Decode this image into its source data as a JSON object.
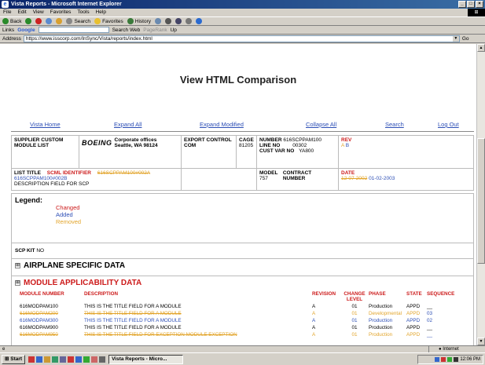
{
  "window": {
    "title": "Vista Reports - Microsoft Internet Explorer",
    "buttons": [
      "_",
      "□",
      "×"
    ]
  },
  "menu": [
    "File",
    "Edit",
    "View",
    "Favorites",
    "Tools",
    "Help"
  ],
  "toolbar": {
    "back": "Back",
    "search": "Search",
    "favorites": "Favorites",
    "history": "History"
  },
  "links_bar": {
    "links_label": "Links",
    "google": "Google",
    "search_web": "Search Web",
    "pagerank": "PageRank",
    "up": "Up"
  },
  "address": {
    "label": "Address",
    "url": "https://www.isscorp.com/InSync/Vista/reports/index.html",
    "go": "Go"
  },
  "page": {
    "title": "View HTML Comparison",
    "nav": [
      "Vista Home",
      "Expand All",
      "Expand Modified",
      "Collapse All",
      "Search",
      "Log Out"
    ]
  },
  "header": {
    "supplier_label": "SUPPLIER CUSTOM MODULE LIST",
    "boeing_logo": "BOEING",
    "corporate": "Corporate offices",
    "city": "Seattle, WA 98124",
    "export_label": "EXPORT CONTROL COM",
    "cage_label": "CAGE",
    "cage_value": "81205",
    "number_label": "NUMBER",
    "number_value": "616SCPPAM100",
    "line_label": "LINE NO",
    "line_value": "00302",
    "custvar_label": "CUST VAR NO",
    "custvar_value": "YA800",
    "rev_label": "REV",
    "rev_old": "A",
    "rev_new": "B",
    "list_title_label": "LIST TITLE",
    "list_title_value": "DESCRIPTION FIELD FOR SCP",
    "scml_label": "SCML IDENTIFIER",
    "scml_old": "616SCPPAM100#002A",
    "scml_new": "616SCPPAM100#002B",
    "model_label": "MODEL",
    "model_value": "757",
    "contract_label": "CONTRACT NUMBER",
    "date_label": "DATE",
    "date_old": "12-07-2002",
    "date_new": "01-02-2003"
  },
  "legend": {
    "title": "Legend:",
    "changed": "Changed",
    "added": "Added",
    "removed": "Removed"
  },
  "scp_kit": {
    "label": "SCP KIT",
    "value": "NO"
  },
  "sections": {
    "airplane": "AIRPLANE SPECIFIC DATA",
    "module": "MODULE APPLICABILITY DATA",
    "expand_glyph": "⊞"
  },
  "module_table": {
    "headers": {
      "module_number": "MODULE NUMBER",
      "description": "DESCRIPTION",
      "revision": "REVISION",
      "change_level": "CHANGE LEVEL",
      "phase": "PHASE",
      "state": "STATE",
      "sequence": "SEQUENCE"
    },
    "rows": [
      {
        "module": "616MODPAM100",
        "desc": "THIS IS THE TITLE FIELD FOR A MODULE",
        "rev": "A",
        "level": "01",
        "phase": "Production",
        "state": "APPD",
        "seq": "__",
        "kind": "normal"
      },
      {
        "module": "616MODPAM200",
        "desc": "THIS IS THE TITLE FIELD FOR A MODULE",
        "rev": "A",
        "level": "01",
        "phase": "Developmental",
        "state": "APPD",
        "seq": "03",
        "kind": "removed"
      },
      {
        "module": "616MODPAM300",
        "desc": "THIS IS THE TITLE FIELD FOR A MODULE",
        "rev": "A",
        "level": "01",
        "phase": "Production",
        "state": "APPD",
        "seq": "02",
        "kind": "added"
      },
      {
        "module": "616MODPAM900",
        "desc": "THIS IS THE TITLE FIELD FOR A MODULE",
        "rev": "A",
        "level": "01",
        "phase": "Production",
        "state": "APPD",
        "seq": "__",
        "kind": "normal"
      },
      {
        "module": "616MODPAM950",
        "desc": "THIS IS THE TITLE FIELD FOR EXCEPTION MODULE EXCEPTION",
        "rev": "A",
        "level": "01",
        "phase": "Production",
        "state": "APPD",
        "seq": "__",
        "kind": "removed"
      }
    ]
  },
  "status": {
    "zone": "Internet"
  },
  "taskbar": {
    "start": "Start",
    "task": "Vista Reports - Micro...",
    "clock": "12:06 PM"
  },
  "colors": {
    "changed": "#cc1a1a",
    "added": "#2d4fb6",
    "removed": "#e2a42a",
    "link": "#2d4fb6"
  }
}
